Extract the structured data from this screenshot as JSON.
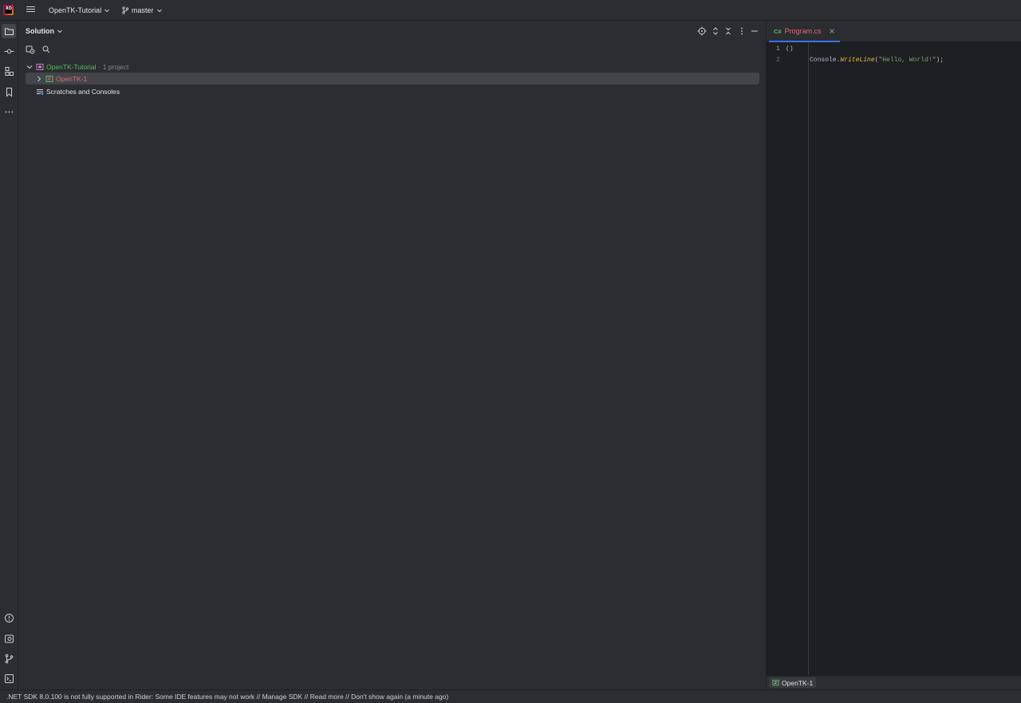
{
  "app": {
    "logo_text": "RD"
  },
  "titlebar": {
    "project_name": "OpenTK-Tutorial",
    "branch": "master"
  },
  "stripe": {
    "top_icons": [
      "folder-icon",
      "commit-icon",
      "structure-icon",
      "bookmark-icon",
      "more-icon"
    ],
    "bottom_icons": [
      "problems-icon",
      "services-icon",
      "git-icon",
      "terminal-icon"
    ]
  },
  "solution": {
    "title": "Solution",
    "tree": [
      {
        "label": "OpenTK-Tutorial",
        "suffix": "· 1 project",
        "color": "#5fb865"
      },
      {
        "label": "OpenTK-1",
        "color": "#e06c75",
        "selected": true
      },
      {
        "label": "Scratches and Consoles",
        "color": "#dfe1e5"
      }
    ]
  },
  "editor": {
    "tab": {
      "lang_badge": "C#",
      "filename": "Program.cs",
      "color": "#e06c75"
    },
    "lines": [
      {
        "no": "1",
        "text": "()"
      },
      {
        "no": "2",
        "code": {
          "obj": "Console",
          "dot": ".",
          "method": "WriteLine",
          "open": "(",
          "string": "\"Hello, World!\"",
          "close": ");"
        }
      }
    ],
    "breadcrumb": "OpenTK-1"
  },
  "status": {
    "message": ".NET SDK 8.0.100 is not fully supported in Rider: Some IDE features may not work // Manage SDK // Read more // Don't show again (a minute ago)"
  },
  "colors": {
    "accent": "#3574f0",
    "solution_green": "#5fb865",
    "project_red": "#e06c75",
    "string": "#6aab73",
    "method": "#e8ba36"
  }
}
